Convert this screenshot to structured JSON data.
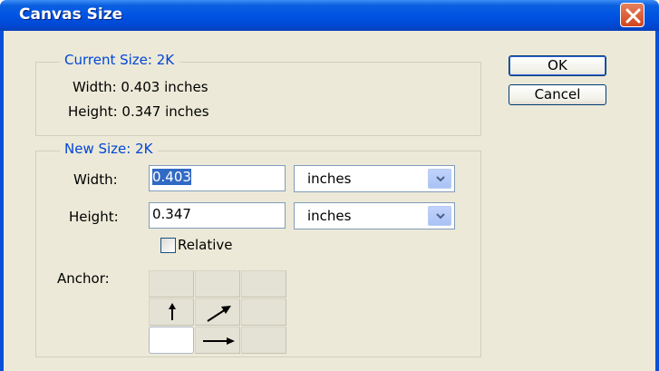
{
  "window": {
    "title": "Canvas Size"
  },
  "current_size": {
    "legend": "Current Size:  2K",
    "width_line": "Width:  0.403 inches",
    "height_line": "Height:  0.347 inches"
  },
  "new_size": {
    "legend": "New Size:  2K",
    "width_label": "Width:",
    "width_value": "0.403",
    "width_unit": "inches",
    "height_label": "Height:",
    "height_value": "0.347",
    "height_unit": "inches",
    "relative_label": "Relative",
    "relative_checked": false,
    "anchor_label": "Anchor:"
  },
  "buttons": {
    "ok": "OK",
    "cancel": "Cancel"
  },
  "icons": {
    "close": "close-icon",
    "dropdown": "chevron-down-icon",
    "anchor_arrows": [
      "arrow-up-icon",
      "arrow-up-right-icon",
      "arrow-right-icon"
    ]
  },
  "colors": {
    "titlebar": "#0054e3",
    "legend_text": "#0046d5",
    "dialog_bg": "#ece9d8",
    "selection": "#316ac5"
  }
}
